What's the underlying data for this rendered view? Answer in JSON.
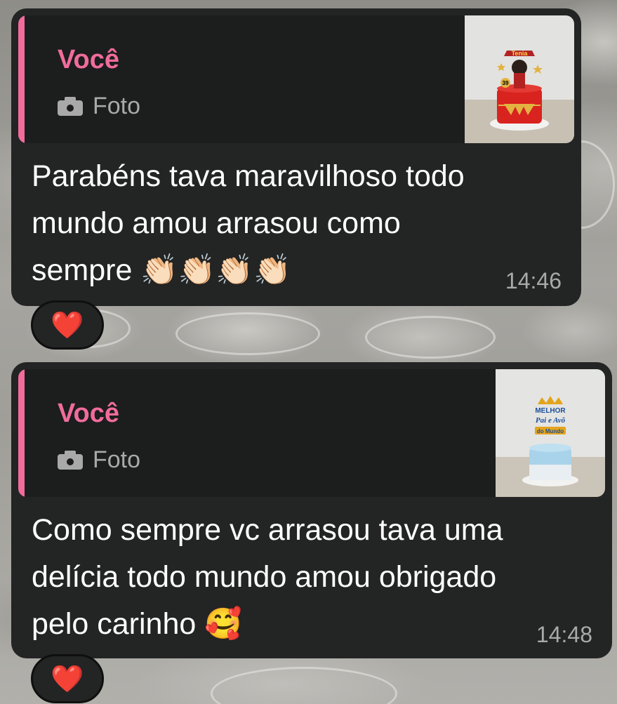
{
  "messages": [
    {
      "quote": {
        "author": "Você",
        "type_label": "Foto",
        "type_icon": "camera-icon",
        "thumbnail": "cake-photo-wonder-woman",
        "thumbnail_text": "Tenia"
      },
      "text": "Parabéns tava maravilhoso  todo\nmundo amou arrasou como\nsempre 👏🏻👏🏻👏🏻👏🏻",
      "time": "14:46",
      "reaction": "❤️"
    },
    {
      "quote": {
        "author": "Você",
        "type_label": "Foto",
        "type_icon": "camera-icon",
        "thumbnail": "cake-photo-blue-melhor-pai",
        "thumbnail_text_top": "MELHOR",
        "thumbnail_text_mid": "Pai e Avô",
        "thumbnail_text_bottom": "do Mundo"
      },
      "text": "Como sempre vc arrasou tava uma\ndelícia todo mundo amou obrigado\npelo carinho 🥰",
      "time": "14:48",
      "reaction": "❤️"
    }
  ],
  "colors": {
    "bubble": "#232424",
    "quote_bg": "#1c1d1d",
    "accent": "#f06c9b",
    "meta_text": "#a9a9a9",
    "reaction_heart": "#e0302f"
  }
}
